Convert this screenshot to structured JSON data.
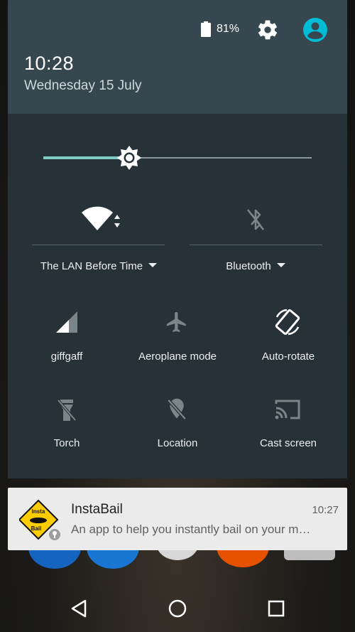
{
  "status": {
    "battery_percent": "81%",
    "battery_icon": "battery-icon",
    "settings_icon": "gear-icon",
    "user_icon": "account-icon"
  },
  "header": {
    "time": "10:28",
    "date": "Wednesday 15 July"
  },
  "brightness": {
    "level": 0.31
  },
  "tiles": {
    "wifi": {
      "label": "The LAN Before Time",
      "icon": "wifi-icon"
    },
    "bluetooth": {
      "label": "Bluetooth",
      "icon": "bluetooth-off-icon"
    },
    "mobile": {
      "label": "giffgaff",
      "icon": "signal-icon"
    },
    "airplane": {
      "label": "Aeroplane mode",
      "icon": "airplane-icon"
    },
    "rotate": {
      "label": "Auto-rotate",
      "icon": "rotate-icon"
    },
    "torch": {
      "label": "Torch",
      "icon": "flashlight-icon"
    },
    "location": {
      "label": "Location",
      "icon": "location-off-icon"
    },
    "cast": {
      "label": "Cast screen",
      "icon": "cast-icon"
    }
  },
  "notification": {
    "app_name": "InstaBail",
    "time": "10:27",
    "text": "An app to help you instantly bail on your m…",
    "logo_text_top": "Insta",
    "logo_text_bottom": "Bail"
  },
  "nav": {
    "back": "back-icon",
    "home": "home-icon",
    "recents": "recents-icon"
  },
  "colors": {
    "accent": "#80cbc4",
    "shade": "#263238",
    "header": "#37474f",
    "avatar": "#00bcd4"
  }
}
